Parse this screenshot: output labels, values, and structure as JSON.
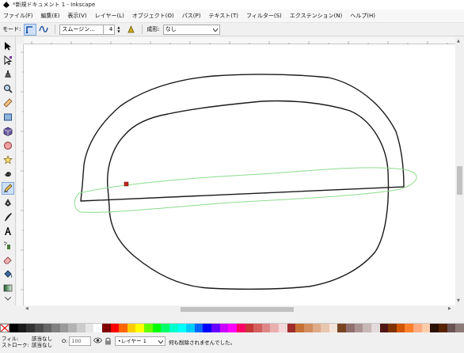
{
  "window": {
    "title": "*新規ドキュメント 1 - Inkscape"
  },
  "menu": [
    "ファイル(F)",
    "編集(E)",
    "表示(V)",
    "レイヤー(L)",
    "オブジェクト(O)",
    "パス(P)",
    "テキスト(T)",
    "フィルター(S)",
    "エクステンション(N)",
    "ヘルプ(H)"
  ],
  "tool_controls": {
    "mode_label": "モード:",
    "smoothing_value": "スムージン...",
    "smoothing_number": "4",
    "shape_label": "成形:",
    "shape_value": "なし"
  },
  "tools": [
    "selector-icon",
    "node-editor-icon",
    "tweak-icon",
    "zoom-icon",
    "measure-icon",
    "rectangle-icon",
    "3d-box-icon",
    "ellipse-icon",
    "star-icon",
    "spiral-icon",
    "pencil-icon",
    "pen-icon",
    "calligraphy-icon",
    "text-icon",
    "spray-icon",
    "eraser-icon",
    "bucket-icon",
    "gradient-icon",
    "dropper-icon"
  ],
  "active_tool": "pencil-icon",
  "palette": [
    "#000000",
    "#1a1a1a",
    "#333333",
    "#4d4d4d",
    "#666666",
    "#808080",
    "#999999",
    "#b3b3b3",
    "#cccccc",
    "#e6e6e6",
    "#ffffff",
    "#800000",
    "#ff0000",
    "#ff6600",
    "#ffcc00",
    "#ffff00",
    "#66ff00",
    "#00ff00",
    "#00ff66",
    "#00ffcc",
    "#00ffff",
    "#00ccff",
    "#0066ff",
    "#0000ff",
    "#6600ff",
    "#cc00ff",
    "#ff00ff",
    "#ff0066",
    "#c83737",
    "#d35f5f",
    "#de8787",
    "#e9afaf",
    "#f4d7d7",
    "#a02c2c",
    "#c87137",
    "#d38d5f",
    "#deaa87",
    "#e9c6af",
    "#f4e3d7",
    "#784421",
    "#916f6f",
    "#ac9393",
    "#c8b7b7",
    "#e3dbdb",
    "#501616",
    "#803300",
    "#d45500",
    "#ff7f2a",
    "#ffaa80",
    "#ffccaa",
    "#2b1100",
    "#552200",
    "#6c5353",
    "#8f7a7a"
  ],
  "status": {
    "fill_label": "フィル:",
    "stroke_label": "ストローク:",
    "fill_value": "該当なし",
    "stroke_value": "該当なし",
    "opacity_label": "O:",
    "opacity_value": "100",
    "layer_value": "•レイヤー 1",
    "message": "何も削除されませんでした。"
  }
}
